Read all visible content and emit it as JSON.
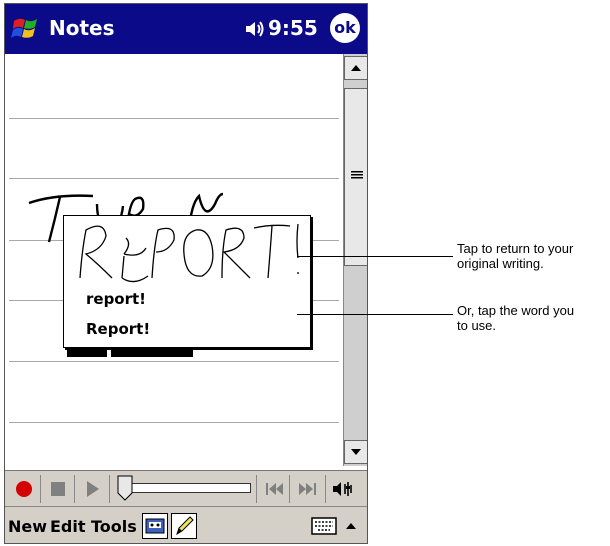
{
  "titlebar": {
    "app_title": "Notes",
    "time": "9:55",
    "ok_label": "ok"
  },
  "popup": {
    "ink_text": "REPORT!",
    "alternatives": [
      "report!",
      "Report!"
    ]
  },
  "note_ink_text": "TURN",
  "menubar": {
    "new": "New",
    "edit": "Edit",
    "tools": "Tools"
  },
  "callouts": [
    {
      "line1": "Tap to return to your",
      "line2": "original writing."
    },
    {
      "line1": "Or, tap the word you",
      "line2": "to use."
    }
  ],
  "colors": {
    "titlebar": "#0b0b8a",
    "record": "#d40000",
    "toolbar": "#d4d0c8"
  }
}
